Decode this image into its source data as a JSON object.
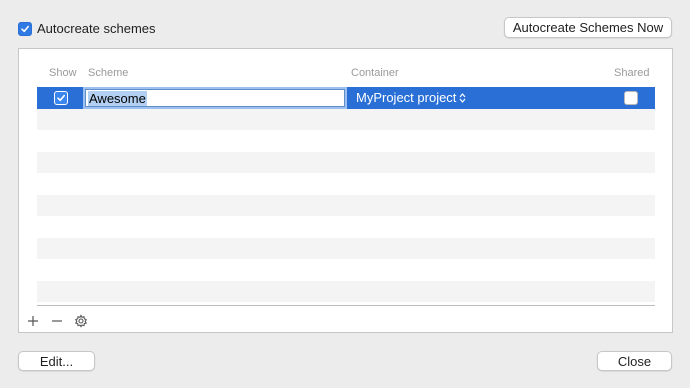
{
  "window": {
    "autocreate_label": "Autocreate schemes",
    "autocreate_checked": true,
    "autocreate_now_label": "Autocreate Schemes Now",
    "edit_label": "Edit...",
    "close_label": "Close"
  },
  "table": {
    "columns": {
      "show": "Show",
      "scheme": "Scheme",
      "container": "Container",
      "shared": "Shared"
    },
    "rows": [
      {
        "show": true,
        "scheme": "Awesome",
        "container": "MyProject project",
        "shared": false
      }
    ]
  },
  "toolbar": {
    "add_icon": "plus-icon",
    "remove_icon": "minus-icon",
    "settings_icon": "gear-icon"
  },
  "colors": {
    "selection": "#2a6fd6",
    "accent": "#2f7ae5",
    "stripe": "#f4f4f4"
  }
}
